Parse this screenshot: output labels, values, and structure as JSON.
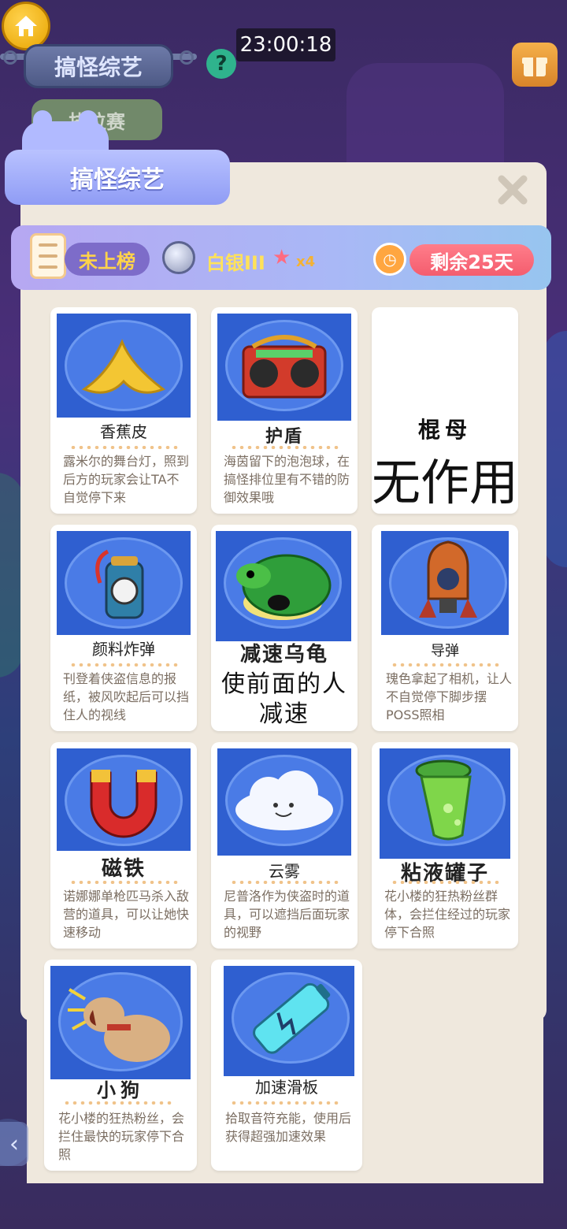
{
  "clock": "23:00:18",
  "sign_title": "搞怪综艺",
  "help_label": "?",
  "rank_tab_label": "排位赛",
  "panel_title": "搞怪综艺",
  "status": {
    "rank_label": "未上榜",
    "tier": "白银III",
    "stars": "x4",
    "remaining": "剩余25天"
  },
  "items": [
    {
      "name": "香蕉皮",
      "icon": "banana-peel",
      "desc": "露米尔的舞台灯，照到后方的玩家会让TA不自觉停下来"
    },
    {
      "name": "护盾",
      "icon": "boombox",
      "desc": "海茵留下的泡泡球，在搞怪排位里有不错的防御效果哦"
    },
    {
      "name": "棍母",
      "overlay": "无作用"
    },
    {
      "name": "颜料炸弹",
      "icon": "paint-bomb",
      "desc": "刊登着侠盗信息的报纸，被风吹起后可以挡住人的视线"
    },
    {
      "name": "减速乌龟",
      "icon": "green-turtle-shell",
      "overlay": "使前面的人减速"
    },
    {
      "name": "导弹",
      "icon": "missile",
      "desc": "瑰色拿起了相机，让人不自觉停下脚步摆POSS照相"
    },
    {
      "name": "磁铁",
      "icon": "magnet",
      "desc": "诺娜娜单枪匹马杀入敌营的道具，可以让她快速移动"
    },
    {
      "name": "云雾",
      "icon": "cloud",
      "desc": "尼普洛作为侠盗时的道具，可以遮挡后面玩家的视野"
    },
    {
      "name": "粘液罐子",
      "icon": "slime-jar",
      "desc": "花小楼的狂热粉丝群体，会拦住经过的玩家停下合照"
    },
    {
      "name": "小狗",
      "icon": "dog",
      "desc": "花小楼的狂热粉丝，会拦住最快的玩家停下合照"
    },
    {
      "name": "加速滑板",
      "icon": "battery",
      "desc": "拾取音符充能，使用后获得超强加速效果"
    }
  ],
  "colors": {
    "accent": "#8f9cf5",
    "remaining_bg": "#f45d6e",
    "panel_bg": "#efe8dd",
    "card_art_bg": "#2f5fd0"
  }
}
